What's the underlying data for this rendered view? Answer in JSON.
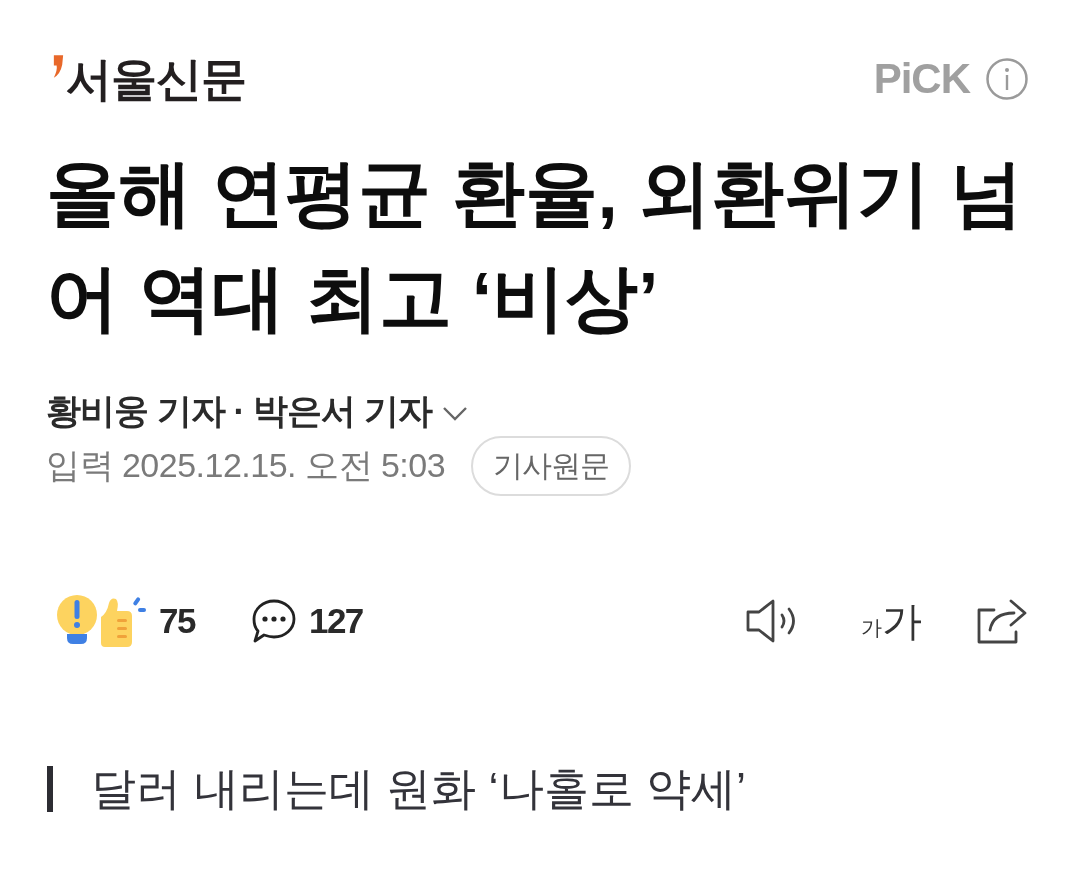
{
  "header": {
    "logo": "서울신문",
    "pick_label": "PiCK"
  },
  "headline": "올해 연평균 환율, 외환위기 넘어 역대 최고 ‘비상’",
  "byline": {
    "reporters": "황비웅 기자 · 박은서 기자",
    "expanded": false
  },
  "meta": {
    "published": "입력 2025.12.15. 오전 5:03",
    "original_button": "기사원문"
  },
  "actions": {
    "reactions_count": "75",
    "comments_count": "127",
    "font_size_glyphs": [
      "가",
      "가"
    ]
  },
  "subtitle": "달러 내리는데 원화 ‘나홀로 약세’"
}
